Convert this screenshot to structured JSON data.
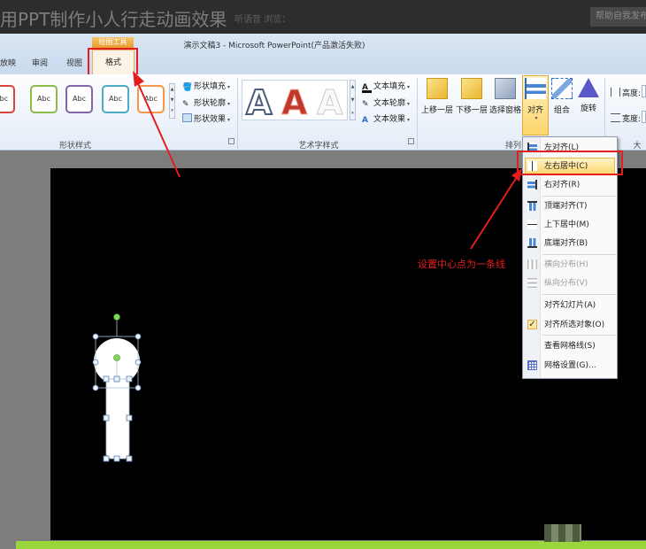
{
  "article": {
    "title": "用PPT制作小人行走动画效果",
    "actions": "听语音  浏览：",
    "header_button": "帮助自我发布"
  },
  "window": {
    "title": "演示文稿3 - Microsoft PowerPoint(产品激活失败)",
    "context_label": "绘图工具"
  },
  "tabs": [
    "放映",
    "审阅",
    "视图",
    "格式"
  ],
  "ribbon": {
    "shape_styles": {
      "label": "形状样式",
      "abc_label": "Abc",
      "abc_colors": [
        "#d9453c",
        "#8dbb4a",
        "#8466a8",
        "#4bacc6",
        "#f79646"
      ],
      "fill": "形状填充",
      "outline": "形状轮廓",
      "effects": "形状效果"
    },
    "wordart": {
      "label": "艺术字样式",
      "glyph": "A",
      "text_fill": "文本填充",
      "text_outline": "文本轮廓",
      "text_effects": "文本效果"
    },
    "arrange": {
      "label": "排列",
      "bring_forward": "上移一层",
      "send_backward": "下移一层",
      "selection_pane": "选择窗格",
      "align": "对齐",
      "group": "组合",
      "rotate": "旋转"
    },
    "size": {
      "label": "大小",
      "height": "高度:",
      "width": "宽度:"
    }
  },
  "align_menu": {
    "items": [
      {
        "label": "左对齐(L)",
        "disabled": false
      },
      {
        "label": "左右居中(C)",
        "disabled": false,
        "highlighted": true
      },
      {
        "label": "右对齐(R)",
        "disabled": false
      },
      {
        "label": "顶端对齐(T)",
        "disabled": false
      },
      {
        "label": "上下居中(M)",
        "disabled": false
      },
      {
        "label": "底端对齐(B)",
        "disabled": false
      },
      {
        "label": "横向分布(H)",
        "disabled": true
      },
      {
        "label": "纵向分布(V)",
        "disabled": true
      },
      {
        "label": "对齐幻灯片(A)",
        "disabled": false
      },
      {
        "label": "对齐所选对象(O)",
        "disabled": false,
        "checked": true
      },
      {
        "label": "查看网格线(S)",
        "disabled": false
      },
      {
        "label": "网格设置(G)...",
        "disabled": false
      }
    ]
  },
  "annotation": "设置中心点为一条线",
  "colors": {
    "highlight_red": "#e41e1e",
    "slide_bg": "#000000",
    "accent_green": "#99d53b"
  }
}
